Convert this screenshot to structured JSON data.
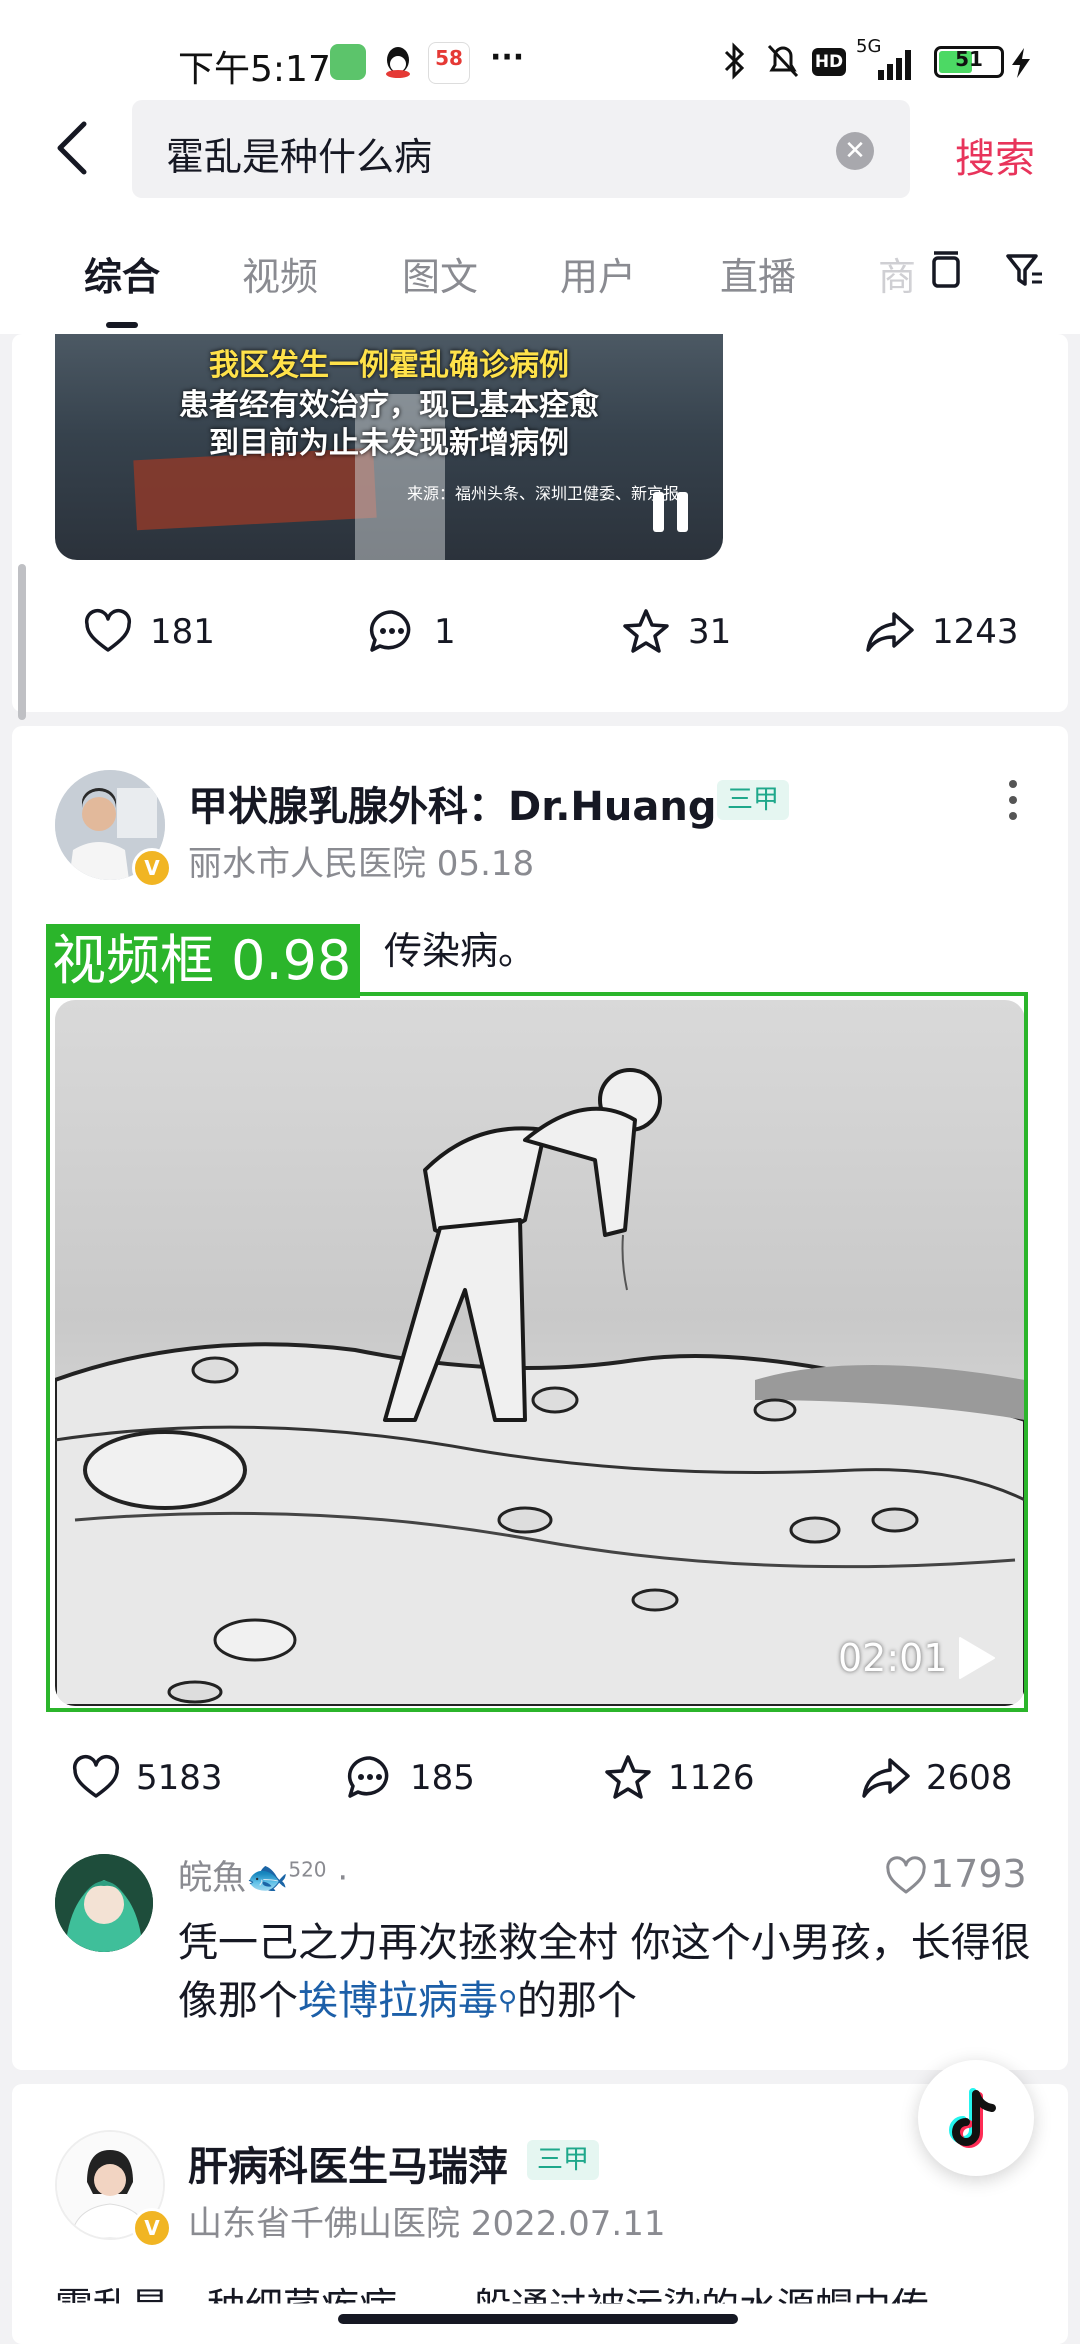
{
  "status_bar": {
    "time": "下午5:17",
    "carrier_tag": "58",
    "network": "5G",
    "hd": "HD",
    "battery": "51",
    "more": "···"
  },
  "search": {
    "query": "霍乱是种什么病",
    "submit_label": "搜索"
  },
  "tabs": [
    "综合",
    "视频",
    "图文",
    "用户",
    "直播",
    "商"
  ],
  "active_tab": "综合",
  "post1": {
    "video_caption_line1": "我区发生一例霍乱确诊病例",
    "video_caption_line2": "患者经有效治疗，现已基本痊愈",
    "video_caption_line3": "到目前为止未发现新增病例",
    "video_source": "来源：福州头条、深圳卫健委、新京报",
    "likes": "181",
    "comments": "1",
    "favorites": "31",
    "shares": "1243"
  },
  "post2": {
    "author": "甲状腺乳腺外科：Dr.Huang",
    "tag": "三甲",
    "meta": "丽水市人民医院 05.18",
    "text": "传染病。",
    "video_duration": "02:01",
    "likes": "5183",
    "comments": "185",
    "favorites": "1126",
    "shares": "2608",
    "top_comment": {
      "user": "皖魚🐟",
      "user_badge": "520",
      "likes": "1793",
      "text_before": "凭一己之力再次拯救全村 你这个小男孩，长得很像那个",
      "link": "埃博拉病毒",
      "text_after": "的那个"
    }
  },
  "detection": {
    "label": "视频框 0.98"
  },
  "post3": {
    "author": "肝病科医生马瑞萍",
    "tag": "三甲",
    "meta": "山东省千佛山医院 2022.07.11",
    "snippet": "霍乱是一种细菌疾病，一般通过被污染的水源帽中传"
  },
  "colors": {
    "accent": "#e8345b",
    "detection": "#2bb52b",
    "tag_bg": "#e5f6f1",
    "tag_text": "#1fa88b",
    "link": "#1c5fa8"
  }
}
